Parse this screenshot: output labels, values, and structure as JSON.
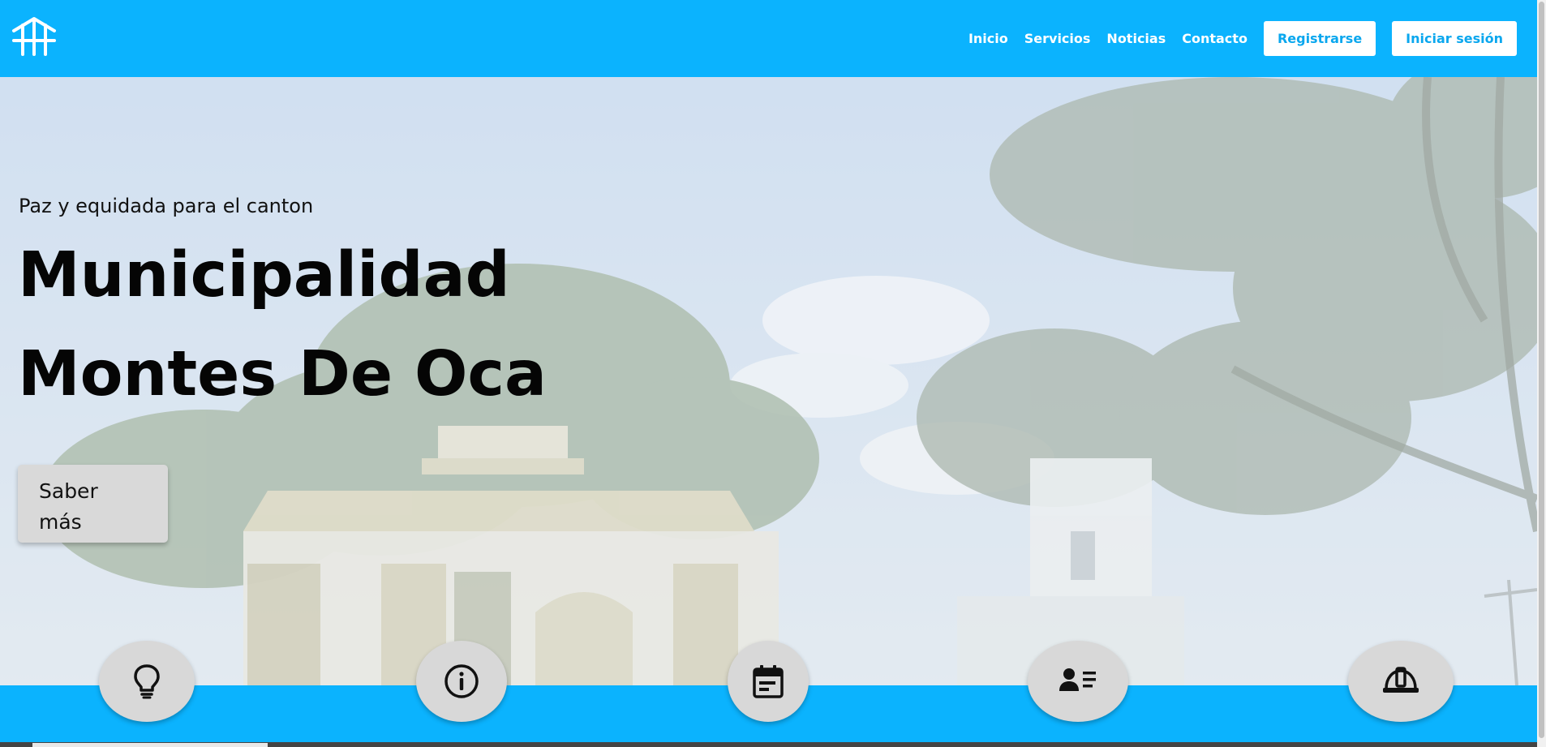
{
  "nav": {
    "links": [
      "Inicio",
      "Servicios",
      "Noticias",
      "Contacto"
    ],
    "register_label": "Registrarse",
    "login_label": "Iniciar sesión"
  },
  "hero": {
    "tagline": "Paz y equidada para el canton",
    "title_line1": "Municipalidad",
    "title_line2": "Montes De Oca",
    "cta_label": "Saber más"
  },
  "features": [
    {
      "icon": "lightbulb-icon"
    },
    {
      "icon": "info-icon"
    },
    {
      "icon": "calendar-icon"
    },
    {
      "icon": "contact-card-icon"
    },
    {
      "icon": "hard-hat-icon"
    }
  ],
  "colors": {
    "brand": "#0bb3fe",
    "button_bg": "#ffffff",
    "button_text": "#0aa7ee",
    "feature_circle": "#d8d8d8"
  }
}
